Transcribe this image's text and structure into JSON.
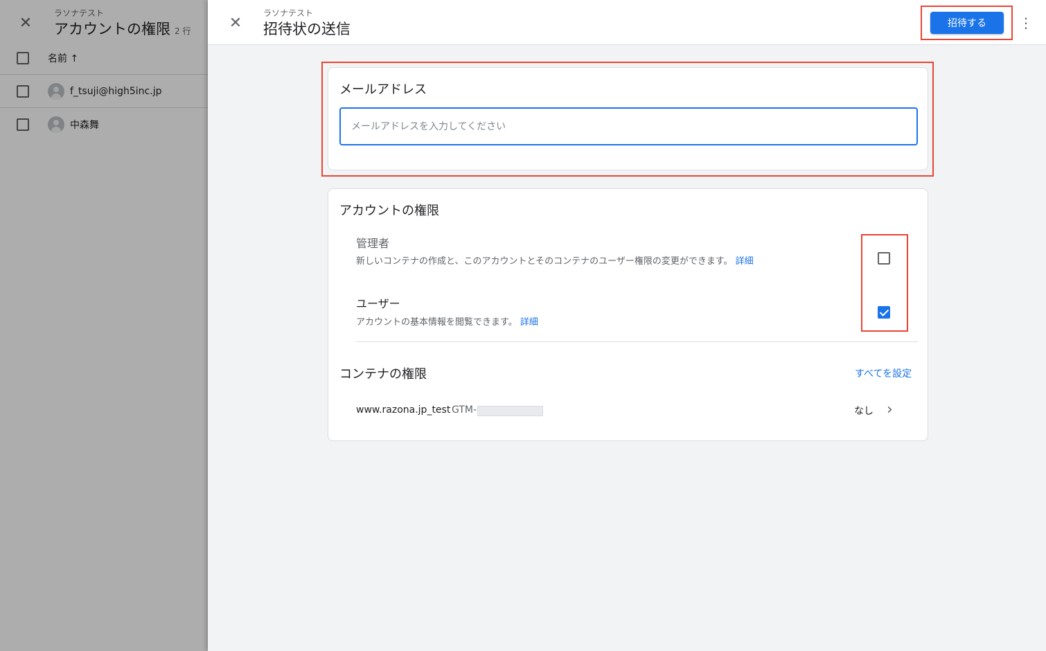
{
  "background": {
    "account_name": "ラソナテスト",
    "title": "アカウントの権限",
    "row_count": "2 行",
    "column_header": "名前 ↑",
    "users": [
      {
        "name": "f_tsuji@high5inc.jp"
      },
      {
        "name": "中森舞"
      }
    ]
  },
  "header": {
    "account_name": "ラソナテスト",
    "title": "招待状の送信",
    "invite_label": "招待する",
    "more_icon": "⋮",
    "close_icon": "✕"
  },
  "email_card": {
    "title": "メールアドレス",
    "input_value": "",
    "placeholder": "メールアドレスを入力してください"
  },
  "account_permissions": {
    "title": "アカウントの権限",
    "roles": [
      {
        "title": "管理者",
        "description": "新しいコンテナの作成と、このアカウントとそのコンテナのユーザー権限の変更ができます。",
        "link": "詳細",
        "checked": false
      },
      {
        "title": "ユーザー",
        "description": "アカウントの基本情報を閲覧できます。",
        "link": "詳細",
        "checked": true
      }
    ]
  },
  "container_permissions": {
    "title": "コンテナの権限",
    "set_all_label": "すべてを設定",
    "containers": [
      {
        "name": "www.razona.jp_test",
        "id_prefix": "GTM-",
        "permission": "なし"
      }
    ]
  },
  "colors": {
    "accent": "#1a73e8",
    "highlight": "#ea4335",
    "sheet_bg": "#f1f3f4"
  }
}
